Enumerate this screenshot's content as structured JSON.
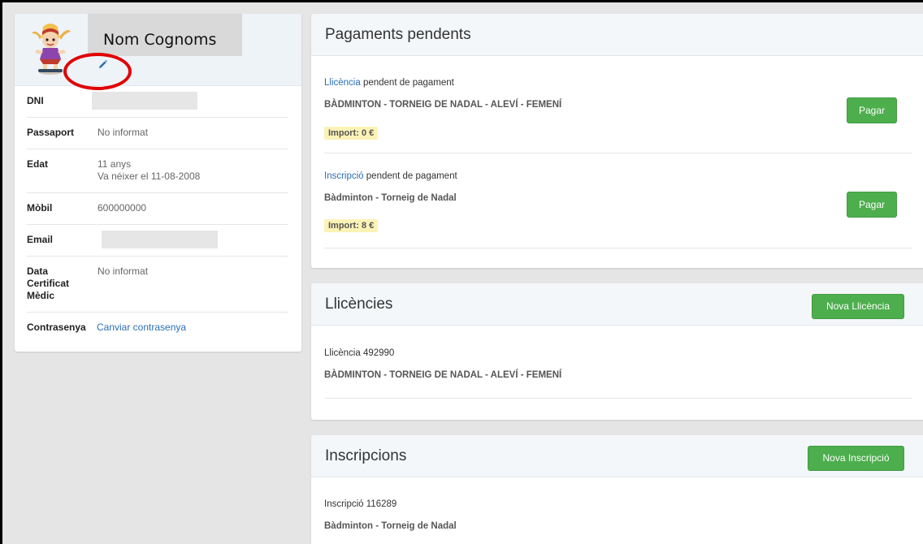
{
  "profile": {
    "name": "Nom Cognoms",
    "rows": [
      {
        "label": "DNI",
        "value": "",
        "redacted": true
      },
      {
        "label": "Passaport",
        "value": "No informat"
      },
      {
        "label": "Edat",
        "value": "11 anys",
        "value2": "Va néixer el 11-08-2008"
      },
      {
        "label": "Mòbil",
        "value": "600000000"
      },
      {
        "label": "Email",
        "value": "",
        "redacted": true
      },
      {
        "label": "Data Certificat Mèdic",
        "value": "No informat"
      },
      {
        "label": "Contrasenya",
        "link": "Canviar contrasenya"
      }
    ]
  },
  "payments": {
    "title": "Pagaments pendents",
    "entries": [
      {
        "type_link": "Llicència",
        "status": " pendent de pagament",
        "description": "BÀDMINTON - TORNEIG DE NADAL - ALEVÍ - FEMENÍ",
        "import": "Import: 0 €",
        "button": "Pagar"
      },
      {
        "type_link": "Inscripció",
        "status": " pendent de pagament",
        "description": "Bàdminton - Torneig de Nadal",
        "import": "Import: 8 €",
        "button": "Pagar"
      }
    ]
  },
  "licences": {
    "title": "Llicències",
    "new_button": "Nova Llicència",
    "entries": [
      {
        "link": "Llicència 492990",
        "description": "BÀDMINTON - TORNEIG DE NADAL - ALEVÍ - FEMENÍ"
      }
    ]
  },
  "inscriptions": {
    "title": "Inscripcions",
    "new_button": "Nova Inscripció",
    "entries": [
      {
        "link": "Inscripció 116289",
        "description": "Bàdminton - Torneig de Nadal"
      }
    ]
  },
  "icons": {
    "edit": "pencil-icon",
    "avatar": "avatar-image"
  },
  "colors": {
    "green": "#4cae4c",
    "link": "#2a6fb5",
    "highlight": "#fbf2b5",
    "annotation": "#e00000"
  }
}
